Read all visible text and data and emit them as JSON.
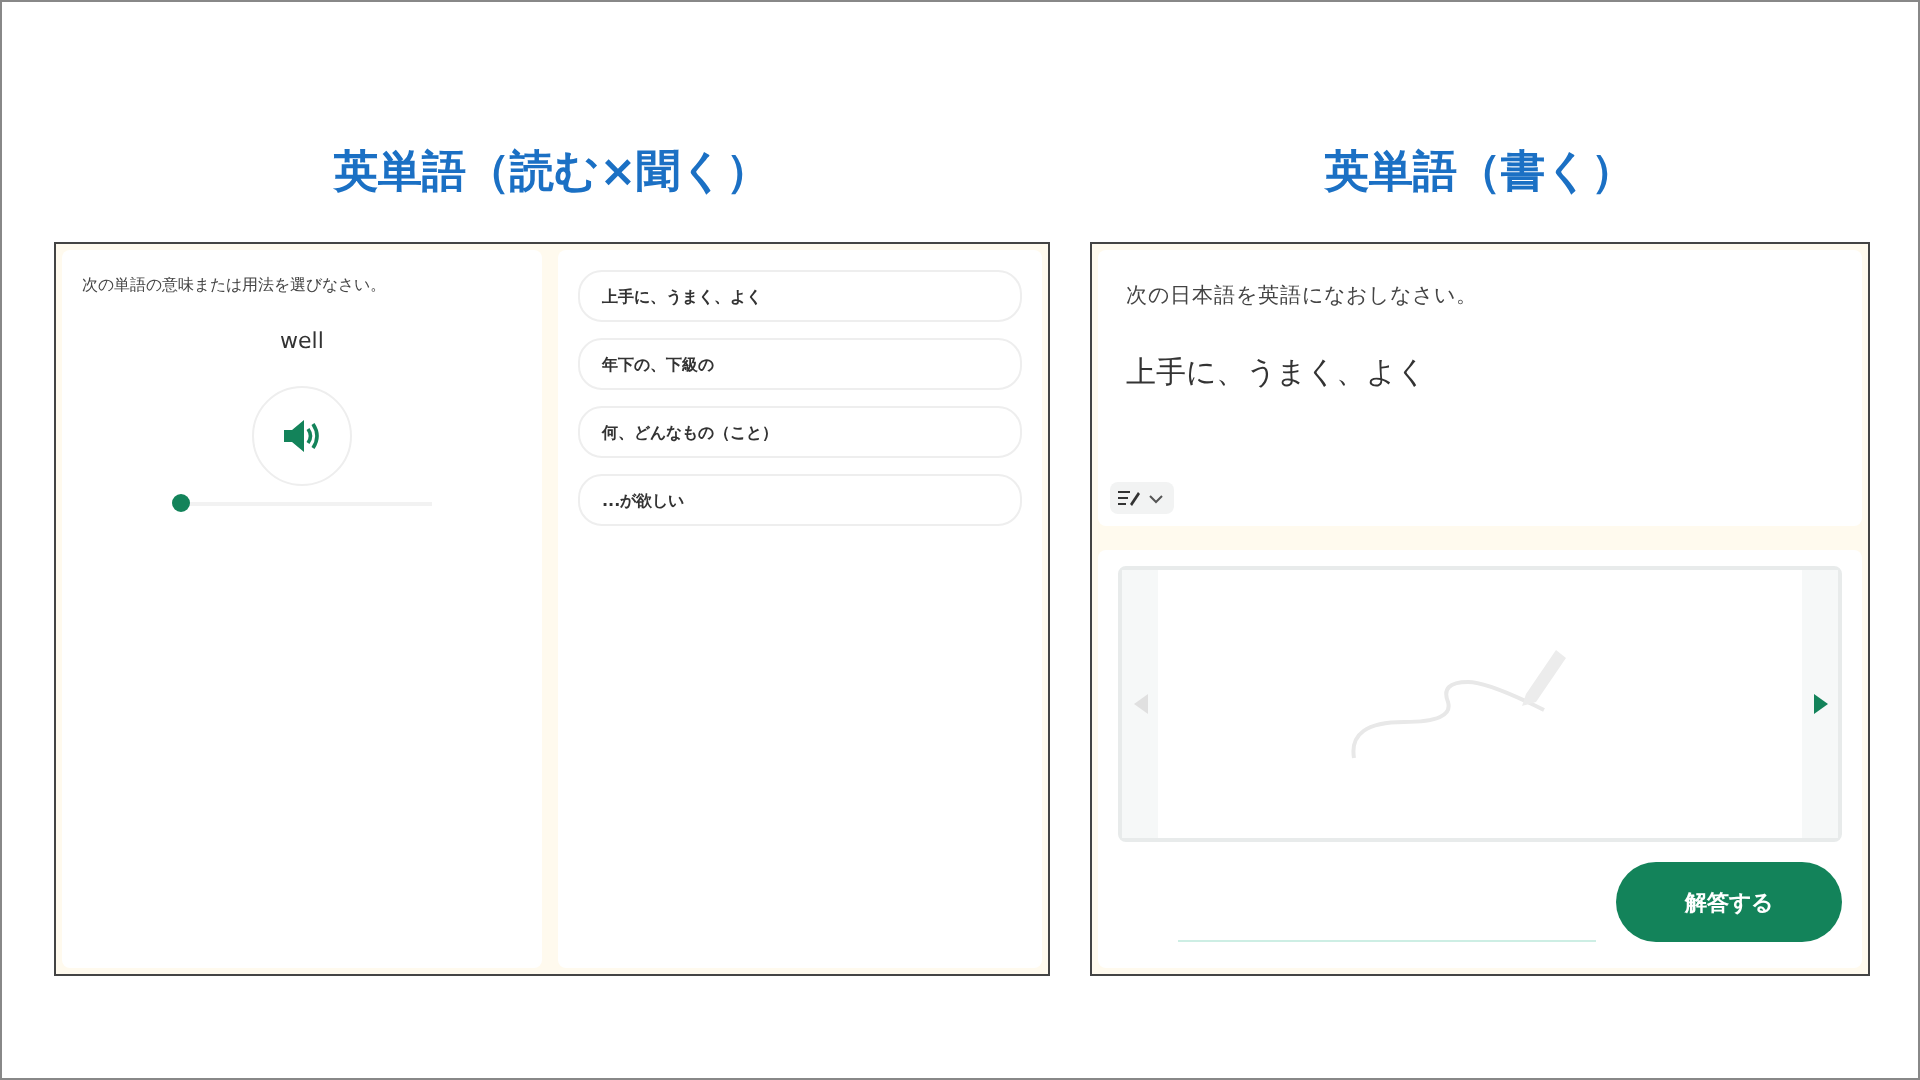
{
  "sections": [
    {
      "title": "英単語（読む×聞く）"
    },
    {
      "title": "英単語（書く）"
    }
  ],
  "reading": {
    "instruction": "次の単語の意味または用法を選びなさい。",
    "word": "well",
    "audio": {
      "level": 0
    },
    "choices": [
      {
        "label": "上手に、うまく、よく"
      },
      {
        "label": "年下の、下級の"
      },
      {
        "label": "何、どんなもの（こと）"
      },
      {
        "label": "...が欲しい"
      }
    ]
  },
  "writing": {
    "instruction": "次の日本語を英語になおしなさい。",
    "prompt": "上手に、うまく、よく",
    "prev_disabled": true,
    "next_disabled": false,
    "answer_button": "解答する"
  }
}
